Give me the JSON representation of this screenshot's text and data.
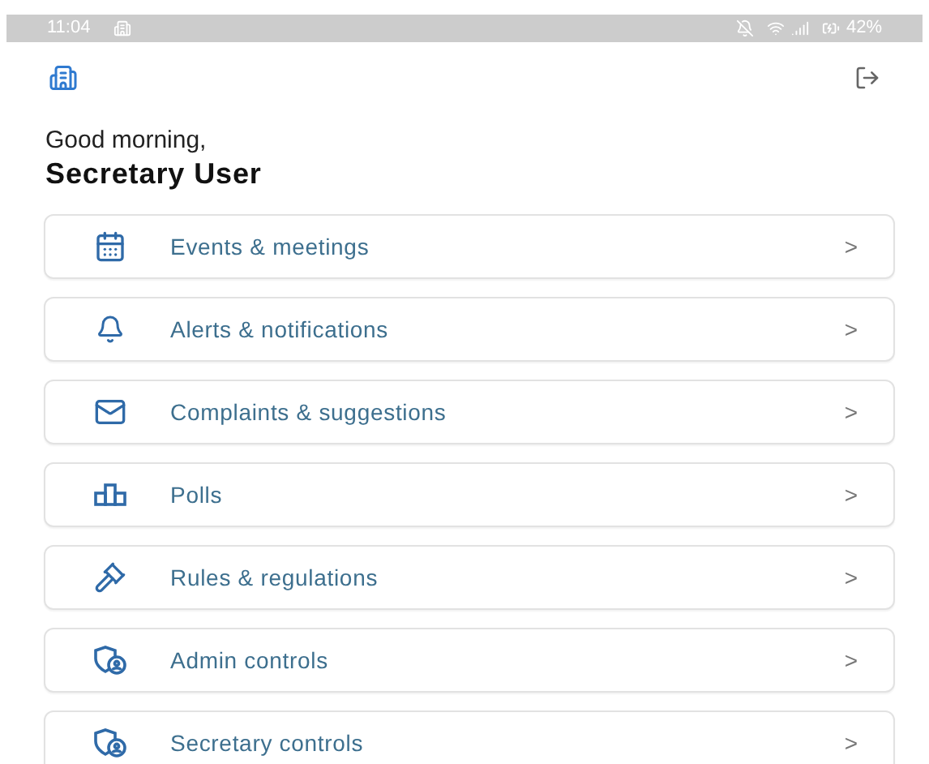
{
  "status_bar": {
    "time": "11:04",
    "battery": "42%"
  },
  "greeting": "Good morning,",
  "user_name": "Secretary User",
  "menu": [
    {
      "kind": "calendar",
      "label": "Events & meetings",
      "chevron": ">"
    },
    {
      "kind": "bell",
      "label": "Alerts & notifications",
      "chevron": ">"
    },
    {
      "kind": "mail",
      "label": "Complaints & suggestions",
      "chevron": ">"
    },
    {
      "kind": "polls",
      "label": "Polls",
      "chevron": ">"
    },
    {
      "kind": "gavel",
      "label": "Rules & regulations",
      "chevron": ">"
    },
    {
      "kind": "shield",
      "label": "Admin controls",
      "chevron": ">"
    },
    {
      "kind": "shield",
      "label": "Secretary controls",
      "chevron": ">"
    }
  ]
}
